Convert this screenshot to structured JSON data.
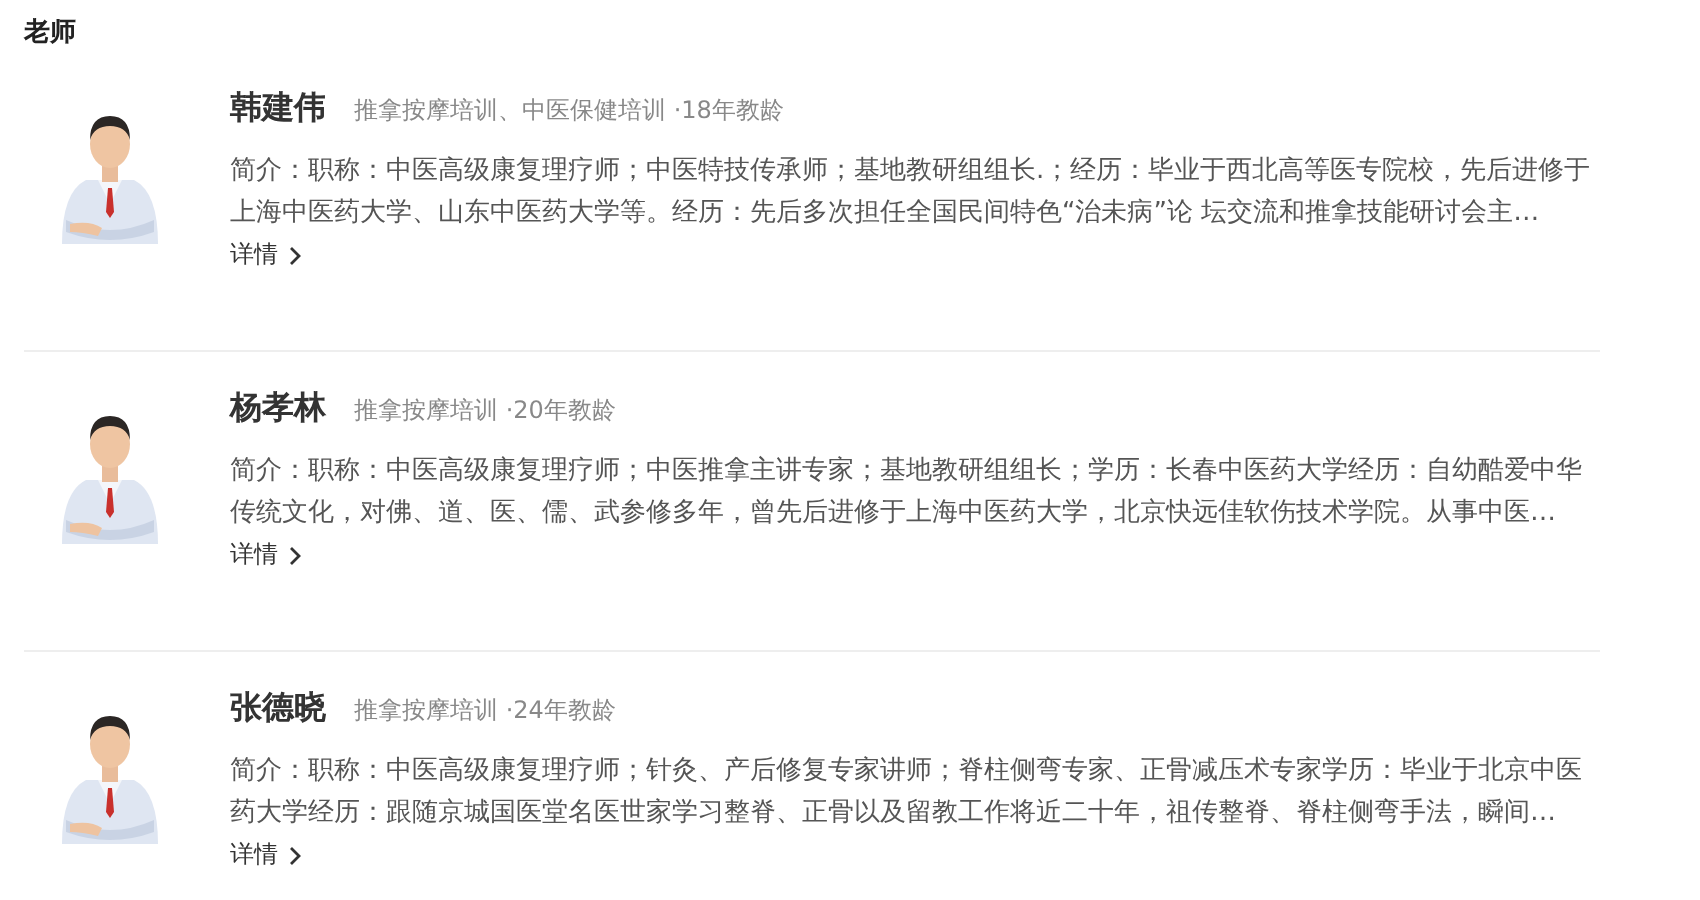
{
  "section_title": "老师",
  "teachers": [
    {
      "name": "韩建伟",
      "tags": "推拿按摩培训、中医保健培训 ·18年教龄",
      "bio": "简介：职称：中医高级康复理疗师；中医特技传承师；基地教研组组长.；经历：毕业于西北高等医专院校，先后进修于上海中医药大学、山东中医药大学等。经历：先后多次担任全国民间特色“治未病”论 坛交流和推拿技能研讨会主…",
      "details": "详情"
    },
    {
      "name": "杨孝林",
      "tags": "推拿按摩培训 ·20年教龄",
      "bio": "简介：职称：中医高级康复理疗师；中医推拿主讲专家；基地教研组组长；学历：长春中医药大学经历：自幼酷爱中华传统文化，对佛、道、医、儒、武参修多年，曾先后进修于上海中医药大学，北京快远佳软伤技术学院。从事中医…",
      "details": "详情"
    },
    {
      "name": "张德晓",
      "tags": "推拿按摩培训 ·24年教龄",
      "bio": "简介：职称：中医高级康复理疗师；针灸、产后修复专家讲师；脊柱侧弯专家、正骨减压术专家学历：毕业于北京中医药大学经历：跟随京城国医堂名医世家学习整脊、正骨以及留教工作将近二十年，祖传整脊、脊柱侧弯手法，瞬间…",
      "details": "详情"
    }
  ]
}
